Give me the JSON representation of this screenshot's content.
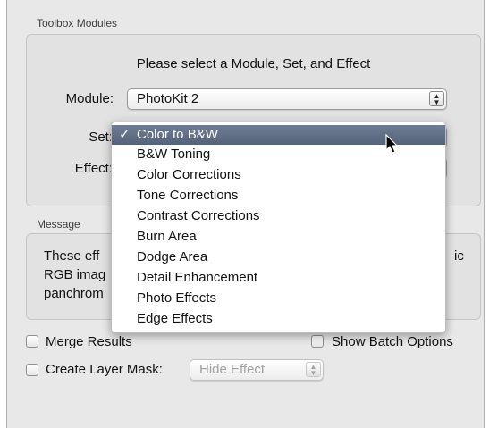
{
  "toolbox": {
    "title": "Toolbox Modules",
    "prompt": "Please select a Module, Set, and Effect",
    "module_label": "Module:",
    "module_value": "PhotoKit 2",
    "set_label": "Set:",
    "effect_label": "Effect:"
  },
  "menu": {
    "items": [
      {
        "label": "Color to B&W",
        "selected": true,
        "checkmark": "✓"
      },
      {
        "label": "B&W Toning"
      },
      {
        "label": "Color Corrections"
      },
      {
        "label": "Tone Corrections"
      },
      {
        "label": "Contrast Corrections"
      },
      {
        "label": "Burn Area"
      },
      {
        "label": "Dodge Area"
      },
      {
        "label": "Detail Enhancement"
      },
      {
        "label": "Photo Effects"
      },
      {
        "label": "Edge Effects"
      }
    ]
  },
  "message": {
    "title": "Message",
    "line1_left": "These eff",
    "line1_right": "ic",
    "line2_left": "RGB imag",
    "line3_left": "panchrom"
  },
  "options": {
    "merge_results": "Merge Results",
    "show_batch_options": "Show Batch Options",
    "create_layer_mask": "Create Layer Mask:",
    "layer_mask_value": "Hide Effect"
  },
  "icons": {
    "cursor": "arrow-cursor-icon",
    "stepper": "up-down-arrows-icon",
    "check": "checkmark-icon"
  },
  "colors": {
    "menu_highlight": "#5f6d84"
  }
}
